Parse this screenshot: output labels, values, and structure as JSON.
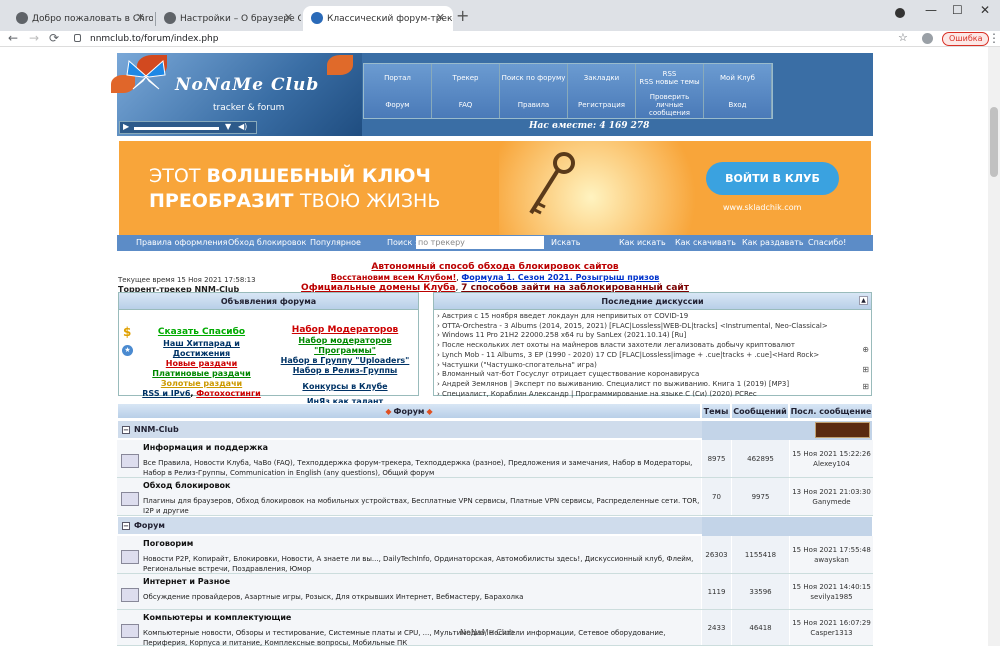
{
  "browser": {
    "tabs": [
      {
        "label": "Добро пожаловать в Chrome!"
      },
      {
        "label": "Настройки – О браузере Chrome"
      },
      {
        "label": "Классический форум-трекер и ..."
      }
    ],
    "url": "nnmclub.to/forum/index.php",
    "error_label": "Ошибка"
  },
  "header": {
    "logo_text": "NoNaMe Club",
    "tagline": "tracker & forum",
    "menu": [
      "Портал",
      "Трекер",
      "Поиск по форуму",
      "Закладки",
      "RSS\nRSS новые темы",
      "Мой Клуб",
      "Форум",
      "FAQ",
      "Правила",
      "Регистрация",
      "Проверить личные сообщения",
      "Вход"
    ],
    "online": "Нас вместе: 4 169 278"
  },
  "banner": {
    "line1_a": "ЭТОТ ",
    "line1_b": "ВОЛШЕБНЫЙ КЛЮЧ",
    "line2_a": "ПРЕОБРАЗИТ ",
    "line2_b": "ТВОЮ ЖИЗНЬ",
    "button": "ВОЙТИ В КЛУБ",
    "url": "www.skladchik.com"
  },
  "navbar": {
    "rules": "Правила оформления",
    "bypass": "Обход блокировок",
    "popular": "Популярное",
    "search_label": "Поиск :",
    "search_placeholder": "по трекеру",
    "search_button": "Искать",
    "how_search": "Как искать",
    "how_download": "Как скачивать",
    "how_seed": "Как раздавать",
    "thanks": "Спасибо!"
  },
  "announce": {
    "title": "Автономный способ обхода блокировок сайтов",
    "line2_a": "Восстановим всем Клубом!",
    "line2_b": "Формула 1. Сезон 2021. Розыгрыш призов",
    "line3_a": "Официальные домены Клуба",
    "line3_b": "7 способов зайти на заблокированный сайт",
    "time": "Текущее время 15 Ноя 2021 17:58:13",
    "site": "Торрент-трекер NNM-Club"
  },
  "ann_box": {
    "header": "Объявления форума",
    "left": [
      {
        "text": "Сказать Спасибо",
        "color": "#0a0"
      },
      {
        "text": "Наш Хитпарад и Достижения",
        "color": "#036"
      },
      {
        "text": "Новые раздачи",
        "color": "#c00"
      },
      {
        "text": "Платиновые раздачи",
        "color": "#080"
      },
      {
        "text": "Золотые раздачи",
        "color": "#c90"
      },
      {
        "text": "RSS и IPv6",
        "color": "#036"
      }
    ],
    "photo": "Фотохостинги",
    "right": [
      {
        "text": "Набор Модераторов",
        "color": "#c00"
      },
      {
        "text": "Набор модераторов \"Программы\"",
        "color": "#080"
      },
      {
        "text": "Набор в Группу \"Uploaders\"",
        "color": "#036"
      },
      {
        "text": "Набор в Релиз-Группы",
        "color": "#036"
      },
      {
        "text": "Конкурсы в Клубе",
        "color": "#036"
      },
      {
        "text": "ИнЯз как талант",
        "color": "#036"
      }
    ]
  },
  "disc_box": {
    "header": "Последние дискуссии",
    "items": [
      "› Австрия с 15 ноября введет локдаун для непривитых от COVID-19",
      "› OTTA-Orchestra - 3 Albums (2014, 2015, 2021) [FLAC|Lossless|WEB-DL|tracks] <Instrumental, Neo-Classical>",
      "› Windows 11 Pro 21H2 22000.258 x64 ru by SanLex (2021.10.14) [Ru]",
      "› После нескольких лет охоты на майнеров власти захотели легализовать добычу криптовалют",
      "› Lynch Mob - 11 Albums, 3 EP (1990 - 2020) 17 CD [FLAC|Lossless|image + .cue|tracks + .cue]<Hard Rock>",
      "› Частушки (\"Частушко-спогательна\" игра)",
      "› Вломанный чат-бот Госуслуг отрицает существование коронавируса",
      "› Андрей Землянов | Эксперт по выживанию. Специалист по выживанию. Книга 1 (2019) [MP3]",
      "› Специалист, Корaблин Александр | Программирование на языке С (Си) (2020) PCRec"
    ]
  },
  "table": {
    "h_forum": "Форум",
    "h_topics": "Темы",
    "h_posts": "Сообщений",
    "h_last": "Посл. сообщение",
    "cat1": "NNM-Club",
    "cat2": "Форум",
    "rows": [
      {
        "title": "Информация и поддержка",
        "subs": "Все Правила,  Новости Клуба,  ЧаВо (FAQ),  Техподдержка форум-трекера,  Техподдержка (разное),  Предложения и замечания,  Набор в Модераторы,  Набор в Релиз-Группы,  Communication in English (any questions),  Общий форум",
        "topics": "8975",
        "posts": "462895",
        "date": "15 Ноя 2021 15:22:26",
        "user": "Alexey104"
      },
      {
        "title": "Обход блокировок",
        "subs": "Плагины для браузеров,  Обход блокировок на мобильных устройствах,  Бесплатные VPN сервисы,  Платные VPN сервисы,  Распределенные сети. TOR, I2P и другие",
        "topics": "70",
        "posts": "9975",
        "date": "13 Ноя 2021 21:03:30",
        "user": "Ganymede"
      },
      {
        "title": "Поговорим",
        "subs": "Новости P2P, Копирайт, Блокировки,  Новости,  А знаете ли вы...,  DailyTechInfo,  Ординаторская,  Автомобилисты здесь!,  Дискуссионный клуб,  Флейм,  Региональные встречи,  Поздравления,  Юмор",
        "topics": "26303",
        "posts": "1155418",
        "date": "15 Ноя 2021 17:55:48",
        "user": "awayskan"
      },
      {
        "title": "Интернет и Разное",
        "subs": "Обсуждение провайдеров,  Азартные игры,  Розыск,  Для открывших Интернет,  Вебмастеру,  Барахолка",
        "topics": "1119",
        "posts": "33596",
        "date": "15 Ноя 2021 14:40:15",
        "user": "sevilya1985"
      },
      {
        "title": "Компьютеры и комплектующие",
        "subs": "Компьютерные новости,  Обзоры и тестирование,  Системные платы и CPU,  ...,  Мультимедиа,  Носители информации,  Сетевое оборудование,  Периферия,  Корпуса и питание,  Комплексные вопросы,  Мобильные ПК",
        "topics": "2433",
        "posts": "46418",
        "date": "15 Ноя 2021 16:07:29",
        "user": "Casper1313"
      }
    ]
  },
  "watermark": "NoNaMe Club"
}
